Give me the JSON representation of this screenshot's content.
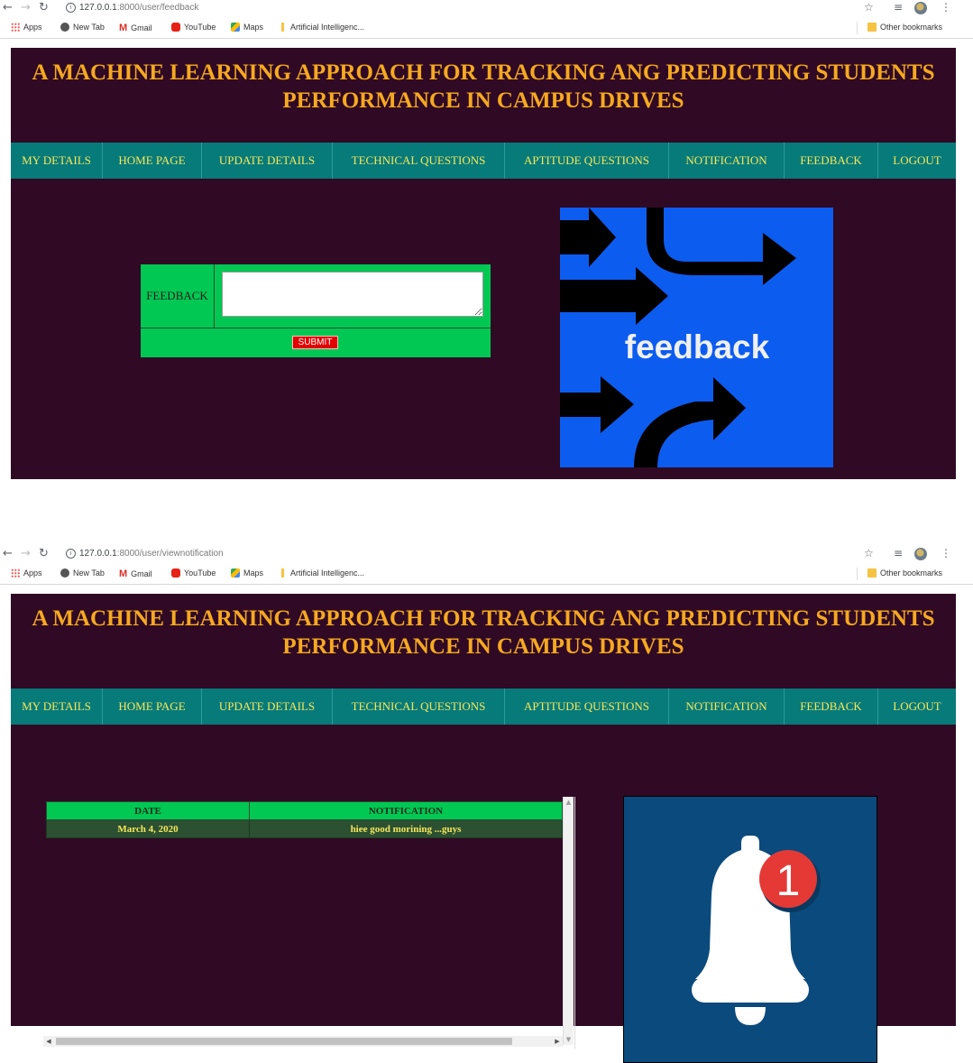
{
  "screens": [
    {
      "browser": {
        "url_host": "127.0.0.1",
        "url_path": ":8000/user/feedback",
        "bookmarks": [
          "Apps",
          "New Tab",
          "Gmail",
          "YouTube",
          "Maps",
          "Artificial Intelligenc..."
        ],
        "other_bookmarks": "Other bookmarks"
      },
      "page": {
        "title_line1": "A MACHINE LEARNING APPROACH FOR TRACKING ANG PREDICTING STUDENTS",
        "title_line2": "PERFORMANCE IN CAMPUS DRIVES",
        "menu": [
          "MY DETAILS",
          "HOME PAGE",
          "UPDATE DETAILS",
          "TECHNICAL QUESTIONS",
          "APTITUDE QUESTIONS",
          "NOTIFICATION",
          "FEEDBACK",
          "LOGOUT"
        ],
        "form": {
          "label": "FEEDBACK",
          "value": "",
          "submit": "SUBMIT"
        },
        "image_text": "feedback"
      }
    },
    {
      "browser": {
        "url_host": "127.0.0.1",
        "url_path": ":8000/user/viewnotification",
        "bookmarks": [
          "Apps",
          "New Tab",
          "Gmail",
          "YouTube",
          "Maps",
          "Artificial Intelligenc..."
        ],
        "other_bookmarks": "Other bookmarks"
      },
      "page": {
        "title_line1": "A MACHINE LEARNING APPROACH FOR TRACKING ANG PREDICTING STUDENTS",
        "title_line2": "PERFORMANCE IN CAMPUS DRIVES",
        "menu": [
          "MY DETAILS",
          "HOME PAGE",
          "UPDATE DETAILS",
          "TECHNICAL QUESTIONS",
          "APTITUDE QUESTIONS",
          "NOTIFICATION",
          "FEEDBACK",
          "LOGOUT"
        ],
        "table": {
          "headers": [
            "DATE",
            "NOTIFICATION"
          ],
          "rows": [
            [
              "March 4, 2020",
              "hiee good morining ...guys"
            ]
          ]
        },
        "badge_count": "1"
      }
    }
  ],
  "colors": {
    "page_bg": "#300a24",
    "title": "#f6a91f",
    "menu_bg": "#077a7a",
    "menu_text": "#f5e85a",
    "form_bg": "#00c853",
    "submit_bg": "#e30000",
    "feedback_img_bg": "#0d5cf0",
    "bell_img_bg": "#0b4a7c",
    "badge": "#e53935"
  }
}
